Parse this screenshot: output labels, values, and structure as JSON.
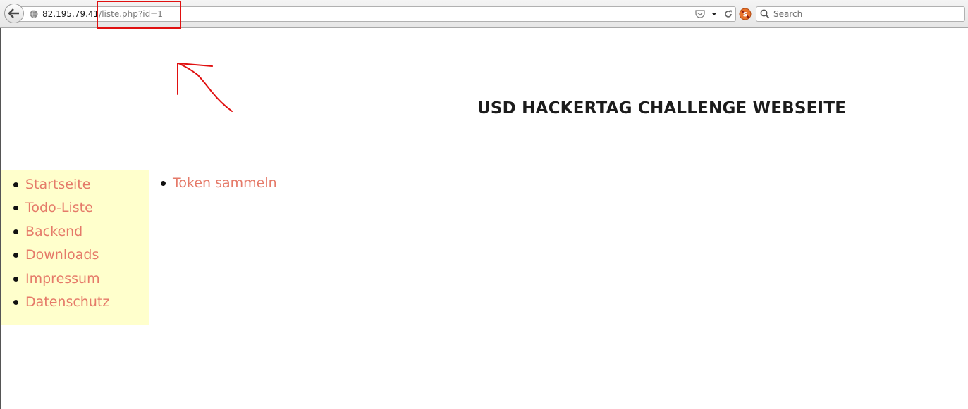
{
  "browser": {
    "url_host": "82.195.79.41",
    "url_path": "/liste.php?id=1",
    "search_placeholder": "Search"
  },
  "page": {
    "title": "USD HACKERTAG CHALLENGE WEBSEITE",
    "nav": [
      {
        "label": "Startseite"
      },
      {
        "label": "Todo-Liste"
      },
      {
        "label": "Backend"
      },
      {
        "label": "Downloads"
      },
      {
        "label": "Impressum"
      },
      {
        "label": "Datenschutz"
      }
    ],
    "content_items": [
      {
        "label": "Token sammeln"
      }
    ]
  },
  "colors": {
    "link": "#e57a69",
    "sidebar_bg": "#ffffcc",
    "annotation": "#e01010"
  },
  "icons": [
    "back-arrow-icon",
    "globe-icon",
    "pocket-icon",
    "dropdown-arrow-icon",
    "reload-icon",
    "noscript-icon",
    "search-icon"
  ]
}
